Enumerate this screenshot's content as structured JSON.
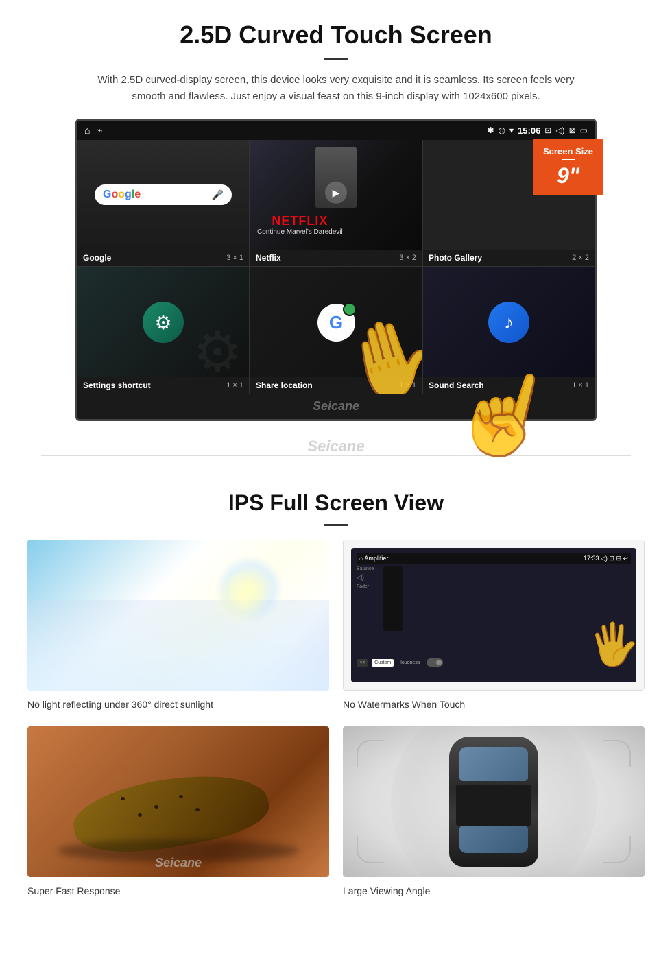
{
  "section1": {
    "title": "2.5D Curved Touch Screen",
    "description": "With 2.5D curved-display screen, this device looks very exquisite and it is seamless. Its screen feels very smooth and flawless. Just enjoy a visual feast on this 9-inch display with 1024x600 pixels.",
    "badge": {
      "title": "Screen Size",
      "size": "9\""
    },
    "status_bar": {
      "time": "15:06"
    },
    "apps": [
      {
        "name": "Google",
        "grid": "3 × 1"
      },
      {
        "name": "Netflix",
        "grid": "3 × 2"
      },
      {
        "name": "Photo Gallery",
        "grid": "2 × 2"
      },
      {
        "name": "Settings shortcut",
        "grid": "1 × 1"
      },
      {
        "name": "Share location",
        "grid": "1 × 1"
      },
      {
        "name": "Sound Search",
        "grid": "1 × 1"
      }
    ],
    "netflix_text": "NETFLIX",
    "netflix_subtitle": "Continue Marvel's Daredevil",
    "watermark": "Seicane"
  },
  "section2": {
    "title": "IPS Full Screen View",
    "items": [
      {
        "caption": "No light reflecting under 360° direct sunlight"
      },
      {
        "caption": "No Watermarks When Touch"
      },
      {
        "caption": "Super Fast Response"
      },
      {
        "caption": "Large Viewing Angle"
      }
    ]
  }
}
